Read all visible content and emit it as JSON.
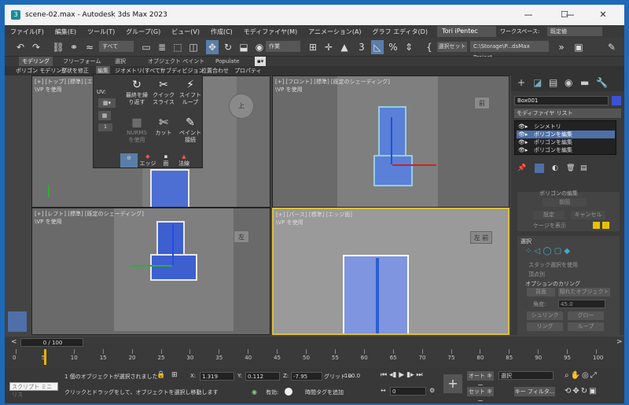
{
  "window": {
    "title": "scene-02.max - Autodesk 3ds Max 2023",
    "minimize": "—",
    "maximize": "☐",
    "close": "✕"
  },
  "menu": {
    "items": [
      "ファイル(F)",
      "編集(E)",
      "ツール(T)",
      "グループ(G)",
      "ビュー(V)",
      "作成(C)",
      "モディファイヤ(M)",
      "アニメーション(A)",
      "グラフ エディタ(D)"
    ],
    "user": "Tori iPentec",
    "workspace_label": "ワークスペース:",
    "workspace_value": "既定値"
  },
  "toolbar": {
    "selection_filter": "すべて",
    "named_set": "作業",
    "create_selection_set": "選択セット",
    "project_path": "C:\\Storage\\P...dsMax Project"
  },
  "ribbon": {
    "tabs": [
      "モデリング",
      "フリーフォーム",
      "選択",
      "オブジェクト ペイント",
      "Populate"
    ],
    "subtabs": [
      "ポリゴン モデリング",
      "形状を修正",
      "編集",
      "ジオメトリ(すべて)",
      "サブディビジョン",
      "位置合わせ",
      "プロパティ"
    ]
  },
  "edit_panel": {
    "uv_label": "UV:",
    "repeat_last": "最終を繰り返す",
    "quick_slice": "クイックスライス",
    "swift_loop": "スイフトループ",
    "nurms": "NURMS を使用",
    "cut": "カット",
    "paint_connect": "ペイント接続",
    "edge": "エッジ",
    "face": "面",
    "normal": "法線",
    "spin_value": "1"
  },
  "viewports": {
    "top": {
      "label": "[+] [トップ] [標準] [エ",
      "sub": "\\VP を使用",
      "cube": "上"
    },
    "front": {
      "label": "[+] [フロント] [標準] [既定のシェーディング]",
      "sub": "\\VP を使用",
      "cube": "前"
    },
    "left": {
      "label": "[+] [レフト] [標準] [既定のシェーディング]",
      "sub": "\\VP を使用",
      "cube": "左"
    },
    "persp": {
      "label": "[+] [パース] [標準] [エッジ面]",
      "sub": "\\VP を使用",
      "cube": "左 前"
    }
  },
  "command_panel": {
    "object_name": "Box001",
    "object_color": "#3c52d6",
    "modifier_list": "モディファイヤ リスト",
    "stack": [
      "シンメトリ",
      "ポリゴンを編集",
      "ポリゴンを編集",
      "ポリゴンを編集"
    ],
    "edit_ops_title": "ポリゴンの編集",
    "previous": "前回",
    "settings": "設定",
    "cancel": "キャンセル",
    "show_cage": "ケージを表示",
    "selection_title": "選択",
    "by_vertex": "スタック選択を使用",
    "by_vertex2": "頂点別",
    "culling": "オプションのカリング",
    "backface": "背面",
    "hidden": "隠れたオブジェクト",
    "angle_label": "角度:",
    "angle_value": "45.0",
    "shrink": "シュリンク",
    "grow": "グロー",
    "ring": "リング",
    "loop": "ループ"
  },
  "timeline": {
    "frame": "0 / 100",
    "ticks": [
      "0",
      "5",
      "10",
      "15",
      "20",
      "25",
      "30",
      "35",
      "40",
      "45",
      "50",
      "55",
      "60",
      "65",
      "70",
      "75",
      "80",
      "85",
      "90",
      "95",
      "100"
    ]
  },
  "status": {
    "script_mini": "スクリプト ミニ リス",
    "msg1": "1 個のオブジェクトが選択されました",
    "msg2": "クリックとドラッグをして、オブジェクトを選択し移動します",
    "x_label": "X:",
    "x": "1.319",
    "y_label": "Y:",
    "y": "0.112",
    "z_label": "Z:",
    "z": "-7.95",
    "grid_label": "グリッド =",
    "grid": "100.0",
    "enabled": "有効:",
    "add_time_tag": "時間タグを追加",
    "autokey": "オート キー",
    "setkey": "セット キー",
    "sel_dropdown": "選択",
    "key_filters": "キー フィルタ...",
    "frame_field": "0"
  }
}
